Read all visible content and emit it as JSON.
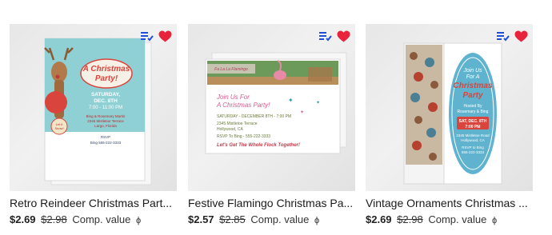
{
  "products": [
    {
      "title": "Retro Reindeer Christmas Party Invitation",
      "title_display": "Retro Reindeer Christmas Part...",
      "price": "$2.69",
      "was_price": "$2.98",
      "comp_label": "Comp. value",
      "info_icon": "ϕ",
      "art": {
        "heading": "A Christmas Party!",
        "date_line1": "SATURDAY,",
        "date_line2": "DEC. 8TH",
        "time": "7:00 - 11:00 PM",
        "host_line": "Bing & Rosemary Martin",
        "address1": "2345 Mistletoe Terrace",
        "address2": "Largo, Florida",
        "rsvp": "RSVP",
        "rsvp_line": "Bing 555-222-3333",
        "badge": "Let it Snow Today!"
      }
    },
    {
      "title": "Festive Flamingo Christmas Party Invitation",
      "title_display": "Festive Flamingo Christmas Pa...",
      "price": "$2.57",
      "was_price": "$2.85",
      "comp_label": "Comp. value",
      "info_icon": "ϕ",
      "art": {
        "banner": "Fa La La Flamingo",
        "heading1": "Join Us For",
        "heading2": "A Christmas Party!",
        "date_line": "SATURDAY - DECEMBER 8TH - 7:00 PM",
        "address1": "2345 Mistletoe Terrace",
        "address2": "Hollywood, CA",
        "rsvp": "RSVP To Bing - 555-222-3333",
        "tagline": "Let's Get The Whole Flock Together!"
      }
    },
    {
      "title": "Vintage Ornaments Christmas Party Invitation",
      "title_display": "Vintage Ornaments Christmas ...",
      "price": "$2.69",
      "was_price": "$2.98",
      "comp_label": "Comp. value",
      "info_icon": "ϕ",
      "art": {
        "heading1": "Join Us",
        "heading2": "For A",
        "heading3": "Christmas",
        "heading4": "Party",
        "host1": "Hosted By",
        "host2": "Rosemary & Bing",
        "date": "SAT, DEC. 8TH",
        "time": "7:00 PM",
        "address1": "2345 Mistletoe Road",
        "address2": "Hollywood, CA",
        "rsvp": "RSVP to Bing",
        "phone": "555-222-3333"
      }
    }
  ],
  "colors": {
    "like": "#e8243c",
    "list_icon": "#1f4fd6",
    "card_bg": "#ececec"
  },
  "icons": [
    "add-to-list-icon",
    "heart-icon",
    "info-icon"
  ]
}
